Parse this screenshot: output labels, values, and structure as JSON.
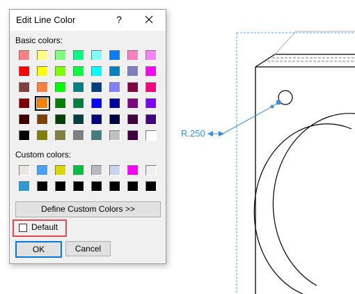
{
  "dialog": {
    "title": "Edit Line Color",
    "help_label": "?",
    "basic_label": "Basic colors:",
    "custom_label": "Custom colors:",
    "define_label": "Define Custom Colors >>",
    "default_label": "Default",
    "ok_label": "OK",
    "cancel_label": "Cancel"
  },
  "basic_colors": [
    "#ff8080",
    "#ffff80",
    "#80ff80",
    "#00ff80",
    "#80ffff",
    "#0080ff",
    "#ff80c0",
    "#ff80ff",
    "#ff0000",
    "#ffff00",
    "#80ff00",
    "#00ff40",
    "#00ffff",
    "#0080c0",
    "#8080c0",
    "#ff00ff",
    "#804040",
    "#ff8040",
    "#00ff00",
    "#008080",
    "#004080",
    "#8080ff",
    "#800040",
    "#ff0080",
    "#800000",
    "#ff8000",
    "#008000",
    "#008040",
    "#0000ff",
    "#0000a0",
    "#800080",
    "#8000ff",
    "#400000",
    "#804000",
    "#004000",
    "#004040",
    "#000080",
    "#000040",
    "#400040",
    "#400080",
    "#000000",
    "#808000",
    "#808040",
    "#808080",
    "#408080",
    "#c0c0c0",
    "#400040",
    "#ffffff"
  ],
  "selected_basic_index": 25,
  "custom_colors": [
    "#e8e8e0",
    "#4aa0ff",
    "#d8d800",
    "#00c040",
    "#b8b8c0",
    "#c8d4f0",
    "#ff00ff",
    "#f0f0f0",
    "#2a9ad0",
    "#000000",
    "#000000",
    "#000000",
    "#000000",
    "#000000",
    "#000000",
    "#000000"
  ],
  "drawing": {
    "radius_label": "R.250"
  }
}
